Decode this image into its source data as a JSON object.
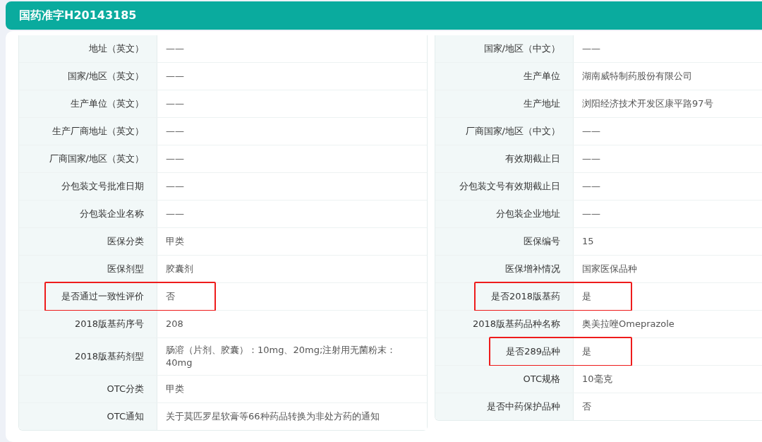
{
  "header": {
    "title": "国药准字H20143185"
  },
  "tables": [
    {
      "rows": [
        {
          "label": "地址（英文）",
          "value": "——",
          "highlighted": false
        },
        {
          "label": "国家/地区（英文）",
          "value": "——",
          "highlighted": false
        },
        {
          "label": "生产单位（英文）",
          "value": "——",
          "highlighted": false
        },
        {
          "label": "生产厂商地址（英文）",
          "value": "——",
          "highlighted": false
        },
        {
          "label": "厂商国家/地区（英文）",
          "value": "——",
          "highlighted": false
        },
        {
          "label": "分包装文号批准日期",
          "value": "——",
          "highlighted": false
        },
        {
          "label": "分包装企业名称",
          "value": "——",
          "highlighted": false
        },
        {
          "label": "医保分类",
          "value": "甲类",
          "highlighted": false
        },
        {
          "label": "医保剂型",
          "value": "胶囊剂",
          "highlighted": false
        },
        {
          "label": "是否通过一致性评价",
          "value": "否",
          "highlighted": true
        },
        {
          "label": "2018版基药序号",
          "value": "208",
          "highlighted": false
        },
        {
          "label": "2018版基药剂型",
          "value": "肠溶（片剂、胶囊）：10mg、20mg;注射用无菌粉末：40mg",
          "highlighted": false
        },
        {
          "label": "OTC分类",
          "value": "甲类",
          "highlighted": false
        },
        {
          "label": "OTC通知",
          "value": "关于莫匹罗星软膏等66种药品转换为非处方药的通知",
          "highlighted": false
        }
      ]
    },
    {
      "rows": [
        {
          "label": "国家/地区（中文）",
          "value": "——",
          "highlighted": false
        },
        {
          "label": "生产单位",
          "value": "湖南威特制药股份有限公司",
          "highlighted": false
        },
        {
          "label": "生产地址",
          "value": "浏阳经济技术开发区康平路97号",
          "highlighted": false
        },
        {
          "label": "厂商国家/地区（中文）",
          "value": "——",
          "highlighted": false
        },
        {
          "label": "有效期截止日",
          "value": "——",
          "highlighted": false
        },
        {
          "label": "分包装文号有效期截止日",
          "value": "——",
          "highlighted": false
        },
        {
          "label": "分包装企业地址",
          "value": "——",
          "highlighted": false
        },
        {
          "label": "医保编号",
          "value": "15",
          "highlighted": false
        },
        {
          "label": "医保增补情况",
          "value": "国家医保品种",
          "highlighted": false
        },
        {
          "label": "是否2018版基药",
          "value": "是",
          "highlighted": true
        },
        {
          "label": "2018版基药品种名称",
          "value": "奥美拉唑Omeprazole",
          "highlighted": false
        },
        {
          "label": "是否289品种",
          "value": "是",
          "highlighted": true
        },
        {
          "label": "OTC规格",
          "value": "10毫克",
          "highlighted": false
        },
        {
          "label": "是否中药保护品种",
          "value": "否",
          "highlighted": false
        }
      ]
    }
  ]
}
